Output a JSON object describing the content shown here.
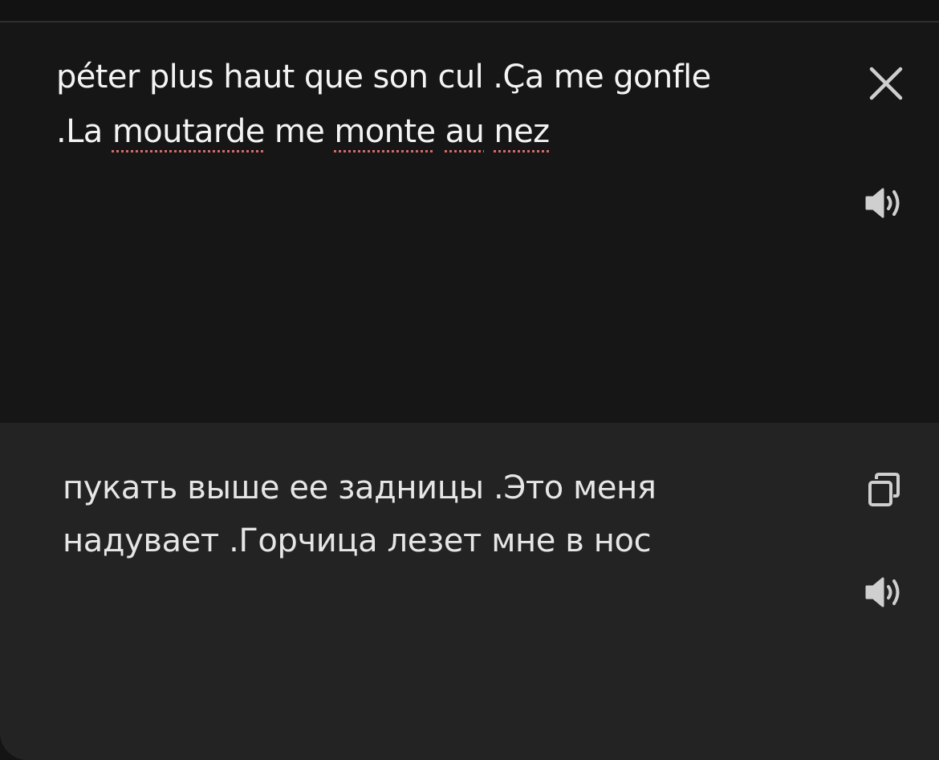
{
  "source": {
    "lines": [
      [
        "péter plus haut que son cul .Ça me gonfle"
      ],
      [
        ".La ",
        "moutarde",
        " me ",
        "monte",
        " ",
        "au",
        " ",
        "nez"
      ]
    ]
  },
  "target": {
    "line1": "пукать выше ее задницы .Это меня",
    "line2": "надувает .Горчица лезет мне в нос"
  },
  "icons": {
    "close": "close-icon",
    "speak_source": "speaker-icon",
    "copy": "copy-icon",
    "speak_target": "speaker-icon"
  },
  "colors": {
    "source_bg": "#161616",
    "target_bg": "#232323",
    "icon": "#cfcfcf",
    "spellcheck_underline": "#d46a6a"
  }
}
